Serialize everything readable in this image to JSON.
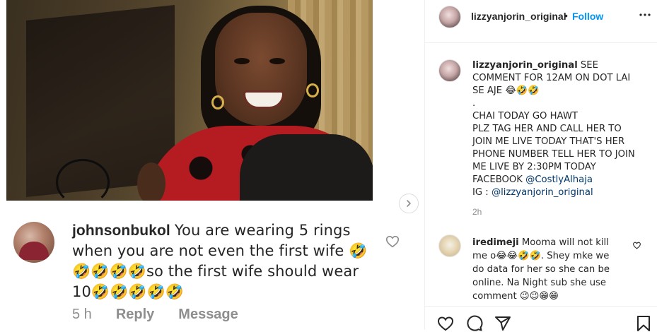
{
  "media": {
    "screenshot_comment": {
      "username": "johnsonbukol",
      "text": "You are wearing 5 rings when you are not even the first wife 🤣🤣🤣🤣🤣so the first wife should wear 10🤣🤣🤣🤣🤣",
      "time": "5 h",
      "reply_label": "Reply",
      "message_label": "Message"
    },
    "next_icon": "chevron-right-icon"
  },
  "post": {
    "header": {
      "username": "lizzyanjorin_original",
      "separator": "•",
      "follow_label": "Follow",
      "more_icon": "more-horizontal-icon"
    },
    "caption": {
      "username": "lizzyanjorin_original",
      "text": "SEE COMMENT FOR 12AM ON DOT LAI SE AJE 😂🤣🤣\n.\nCHAI TODAY GO HAWT\nPLZ TAG HER AND CALL HER TO JOIN ME LIVE TODAY THAT'S HER PHONE NUMBER TELL HER TO JOIN ME LIVE BY 2:30PM TODAY\nFACEBOOK ",
      "facebook_link": "@CostlyAlhaja",
      "ig_prefix": "\nIG : ",
      "ig_link": "@lizzyanjorin_original",
      "time": "2h"
    },
    "comments": [
      {
        "username": "iredimeji",
        "text": "Mooma will not kill me o😂😂🤣🤣. Shey mke we do data for her so she can be online. Na Night sub she use comment 😉😉😁😁",
        "heart_icon": "heart-outline-icon"
      }
    ],
    "actions": {
      "like_icon": "heart-icon",
      "comment_icon": "comment-icon",
      "share_icon": "share-icon",
      "save_icon": "bookmark-icon"
    }
  }
}
